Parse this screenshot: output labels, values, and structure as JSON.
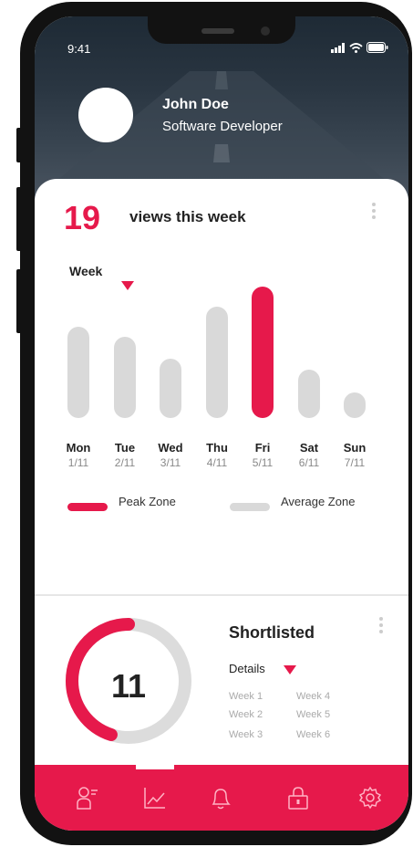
{
  "status_bar": {
    "time": "9:41"
  },
  "profile": {
    "name": "John Doe",
    "role": "Software Developer"
  },
  "views": {
    "count": "19",
    "label": "views this week"
  },
  "period_selector": {
    "label": "Week"
  },
  "days": [
    {
      "day": "Mon",
      "date": "1/11",
      "value": 0.62,
      "peak": false
    },
    {
      "day": "Tue",
      "date": "2/11",
      "value": 0.55,
      "peak": false
    },
    {
      "day": "Wed",
      "date": "3/11",
      "value": 0.4,
      "peak": false
    },
    {
      "day": "Thu",
      "date": "4/11",
      "value": 0.75,
      "peak": false
    },
    {
      "day": "Fri",
      "date": "5/11",
      "value": 0.89,
      "peak": true
    },
    {
      "day": "Sat",
      "date": "6/11",
      "value": 0.33,
      "peak": false
    },
    {
      "day": "Sun",
      "date": "7/11",
      "value": 0.17,
      "peak": false
    }
  ],
  "legend": {
    "peak": "Peak Zone",
    "average": "Average Zone"
  },
  "shortlisted": {
    "title": "Shortlisted",
    "count": "11",
    "progress": 0.45,
    "details_label": "Details",
    "weeks": [
      "Week 1",
      "Week 2",
      "Week 3",
      "Week 4",
      "Week 5",
      "Week 6"
    ]
  },
  "tabs": [
    {
      "icon": "user-list-icon",
      "active": false
    },
    {
      "icon": "chart-icon",
      "active": true
    },
    {
      "icon": "bell-icon",
      "active": false
    },
    {
      "icon": "lock-icon",
      "active": false
    },
    {
      "icon": "gear-icon",
      "active": false
    }
  ],
  "colors": {
    "accent": "#e6194b",
    "bar_inactive": "#d9d9d9",
    "header": "#2a3642"
  }
}
